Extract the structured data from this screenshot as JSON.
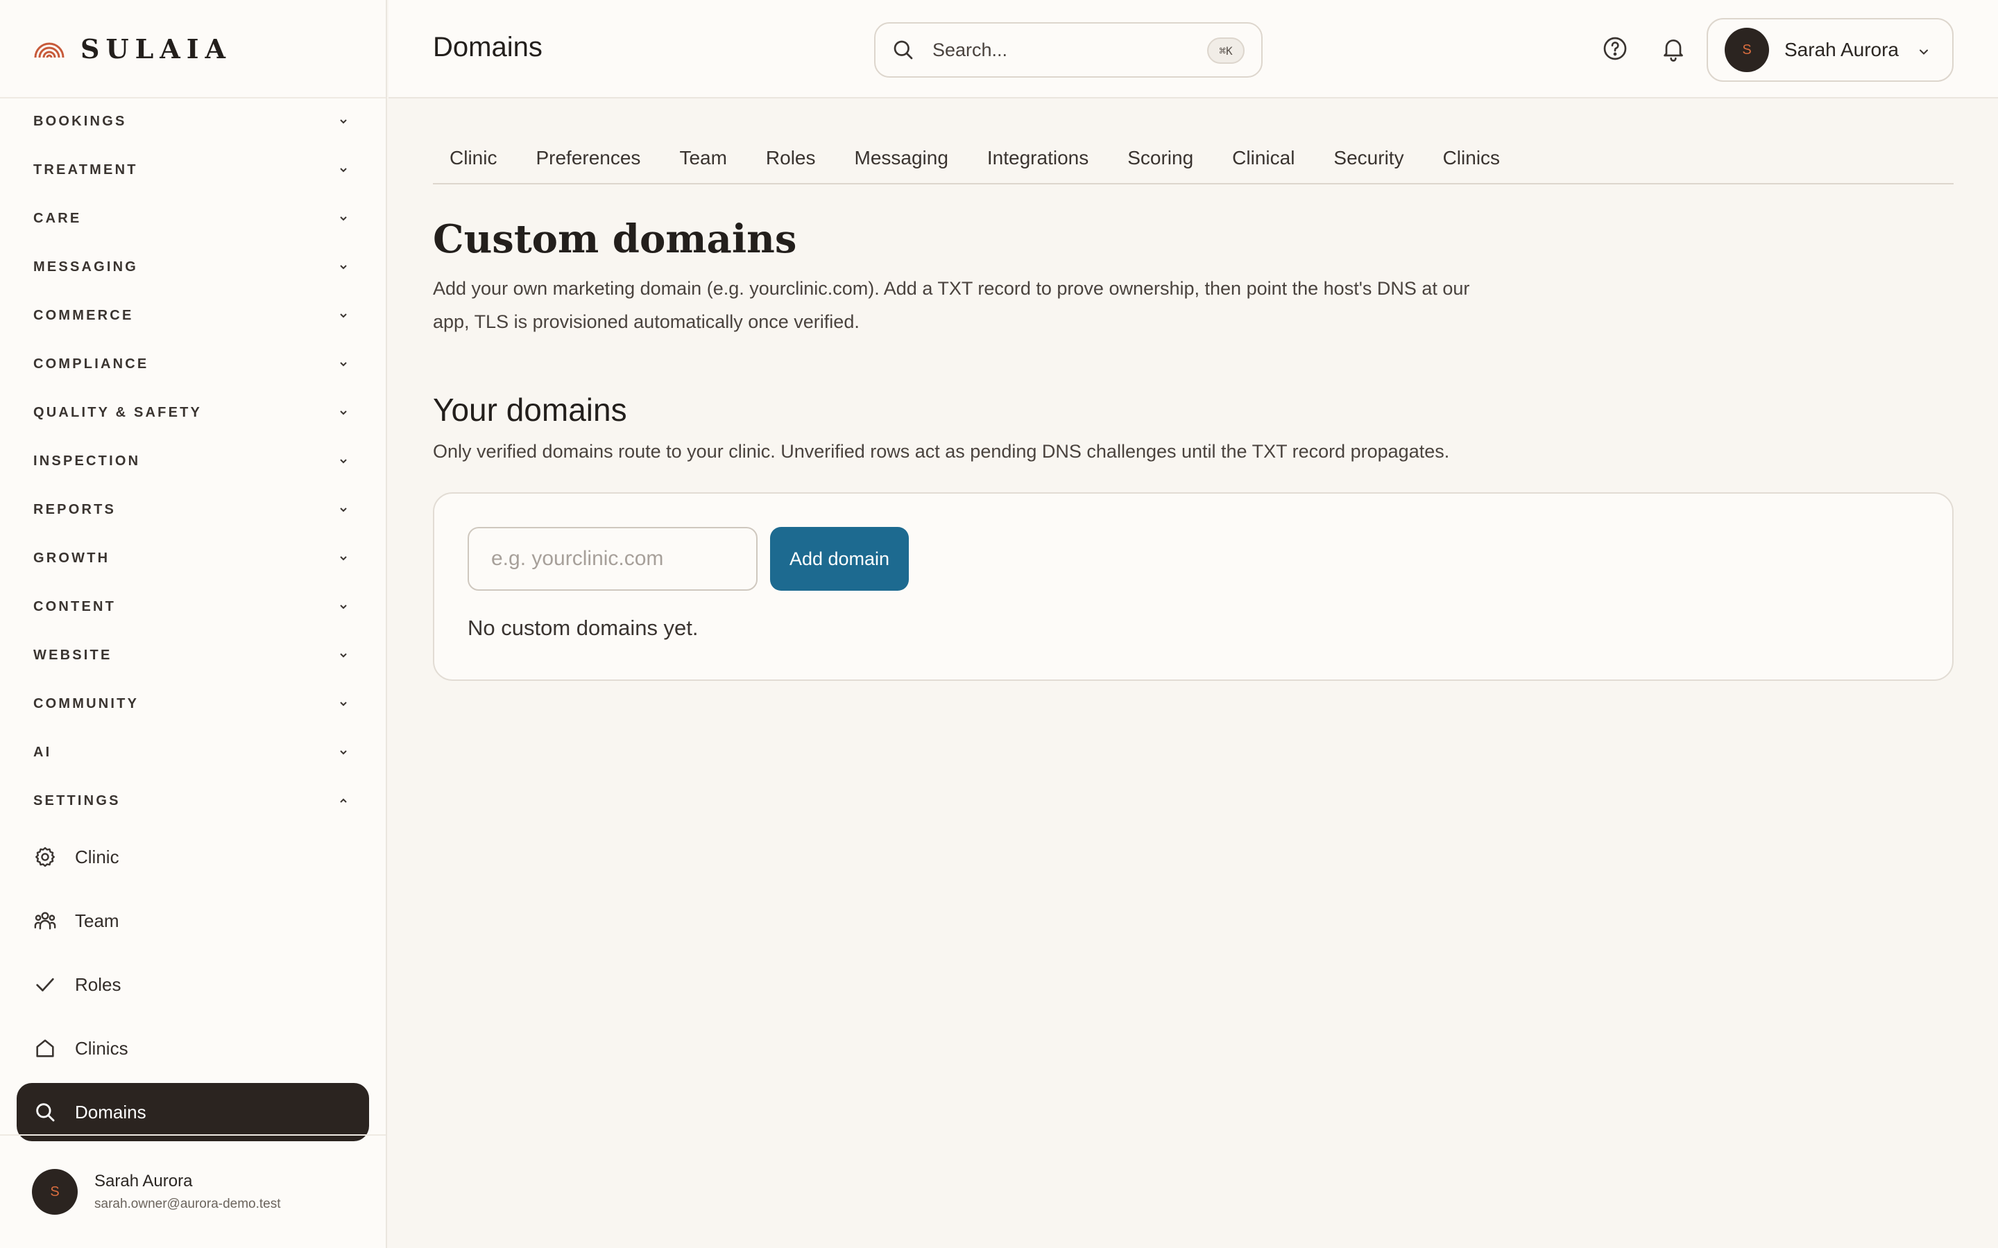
{
  "brand": {
    "name": "SULAIA",
    "accent": "#c75a3a"
  },
  "sidebar": {
    "sections": [
      {
        "label": "BOOKINGS",
        "expanded": false
      },
      {
        "label": "TREATMENT",
        "expanded": false
      },
      {
        "label": "CARE",
        "expanded": false
      },
      {
        "label": "MESSAGING",
        "expanded": false
      },
      {
        "label": "COMMERCE",
        "expanded": false
      },
      {
        "label": "COMPLIANCE",
        "expanded": false
      },
      {
        "label": "QUALITY & SAFETY",
        "expanded": false
      },
      {
        "label": "INSPECTION",
        "expanded": false
      },
      {
        "label": "REPORTS",
        "expanded": false
      },
      {
        "label": "GROWTH",
        "expanded": false
      },
      {
        "label": "CONTENT",
        "expanded": false
      },
      {
        "label": "WEBSITE",
        "expanded": false
      },
      {
        "label": "COMMUNITY",
        "expanded": false
      },
      {
        "label": "AI",
        "expanded": false
      },
      {
        "label": "SETTINGS",
        "expanded": true
      }
    ],
    "settings_items": [
      {
        "label": "Clinic",
        "icon": "gear-icon",
        "active": false
      },
      {
        "label": "Team",
        "icon": "team-icon",
        "active": false
      },
      {
        "label": "Roles",
        "icon": "check-icon",
        "active": false
      },
      {
        "label": "Clinics",
        "icon": "home-icon",
        "active": false
      },
      {
        "label": "Domains",
        "icon": "search-icon",
        "active": true
      }
    ],
    "user": {
      "initial": "S",
      "name": "Sarah Aurora",
      "email": "sarah.owner@aurora-demo.test"
    }
  },
  "header": {
    "title": "Domains",
    "search": {
      "placeholder": "Search...",
      "shortcut": "⌘K"
    },
    "user": {
      "initial": "S",
      "name": "Sarah Aurora"
    }
  },
  "tabs": [
    "Clinic",
    "Preferences",
    "Team",
    "Roles",
    "Messaging",
    "Integrations",
    "Scoring",
    "Clinical",
    "Security",
    "Clinics"
  ],
  "main": {
    "heading": "Custom domains",
    "description": "Add your own marketing domain (e.g. yourclinic.com). Add a TXT record to prove ownership, then point the host's DNS at our app, TLS is provisioned automatically once verified.",
    "section_title": "Your domains",
    "section_description": "Only verified domains route to your clinic. Unverified rows act as pending DNS challenges until the TXT record propagates.",
    "input_placeholder": "e.g. yourclinic.com",
    "add_button": "Add domain",
    "empty_state": "No custom domains yet."
  },
  "colors": {
    "primary_button": "#1d6a90",
    "active_nav": "#2b2420",
    "avatar_bg": "#2b2420",
    "avatar_text": "#d96d3f"
  }
}
